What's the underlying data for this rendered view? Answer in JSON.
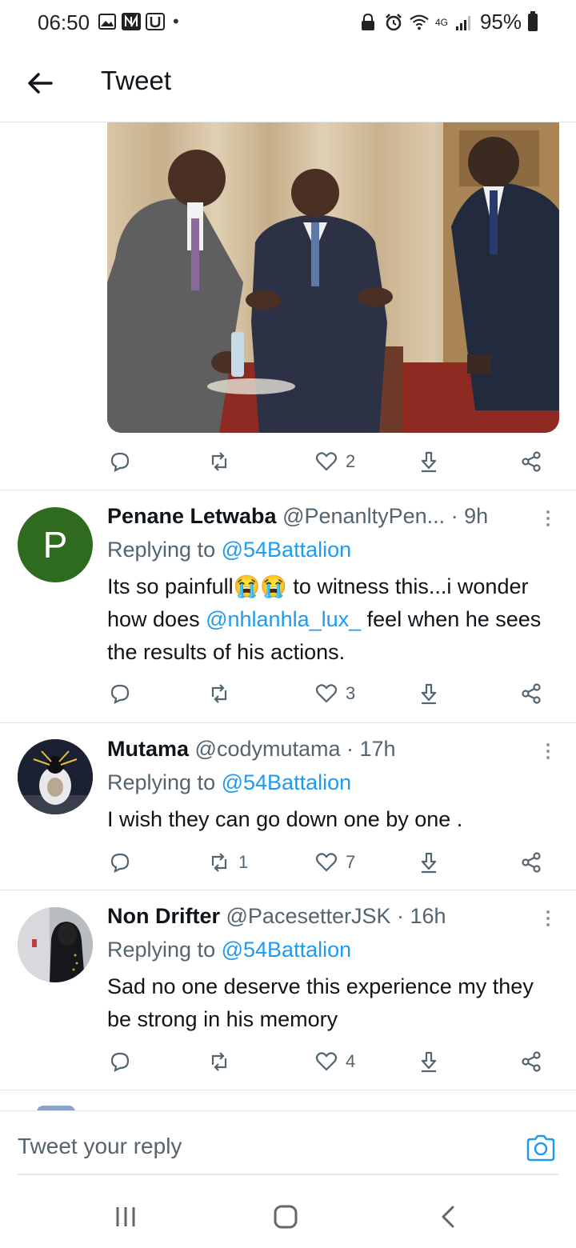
{
  "status": {
    "time": "06:50",
    "battery": "95%",
    "network": "4G"
  },
  "header": {
    "title": "Tweet"
  },
  "main_tweet": {
    "likes": "2"
  },
  "replies": [
    {
      "name": "Penane Letwaba",
      "handle": "@PenanltyPen...",
      "time": "· 9h",
      "replying_label": "Replying to",
      "replying_to": "@54Battalion",
      "body_parts": [
        "Its so painfull",
        "😭😭",
        " to witness this...i wonder how does ",
        "@nhlanhla_lux_",
        " feel when he sees the results of his actions."
      ],
      "retweets": "",
      "likes": "3",
      "avatar_letter": "P"
    },
    {
      "name": "Mutama",
      "handle": "@codymutama",
      "time": "· 17h",
      "replying_label": "Replying to",
      "replying_to": "@54Battalion",
      "body": "I wish they can go down one by one .",
      "retweets": "1",
      "likes": "7"
    },
    {
      "name": "Non Drifter",
      "handle": "@PacesetterJSK",
      "time": "· 16h",
      "replying_label": "Replying to",
      "replying_to": "@54Battalion",
      "body": "Sad no one deserve this experience my they be strong in his memory",
      "retweets": "",
      "likes": "4"
    }
  ],
  "reply_bar": {
    "placeholder": "Tweet your reply"
  },
  "colors": {
    "accent": "#1d9bf0",
    "muted": "#536471",
    "avatar_green": "#2e6b1f"
  }
}
